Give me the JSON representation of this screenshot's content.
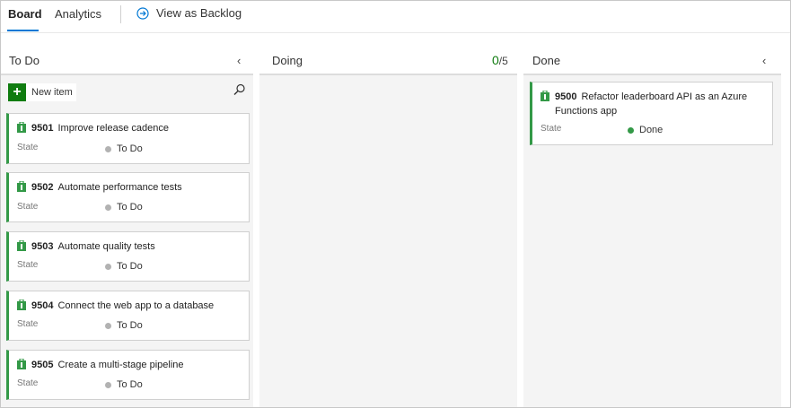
{
  "tabs": {
    "board": "Board",
    "analytics": "Analytics"
  },
  "view_as_backlog": "View as Backlog",
  "columns": {
    "todo": {
      "title": "To Do",
      "new_item": "New item"
    },
    "doing": {
      "title": "Doing",
      "wip_count": "0",
      "wip_limit": "/5"
    },
    "done": {
      "title": "Done"
    }
  },
  "cards_todo": [
    {
      "id": "9501",
      "title": "Improve release cadence",
      "state_label": "State",
      "state": "To Do"
    },
    {
      "id": "9502",
      "title": "Automate performance tests",
      "state_label": "State",
      "state": "To Do"
    },
    {
      "id": "9503",
      "title": "Automate quality tests",
      "state_label": "State",
      "state": "To Do"
    },
    {
      "id": "9504",
      "title": "Connect the web app to a database",
      "state_label": "State",
      "state": "To Do"
    },
    {
      "id": "9505",
      "title": "Create a multi-stage pipeline",
      "state_label": "State",
      "state": "To Do"
    }
  ],
  "cards_done": [
    {
      "id": "9500",
      "title": "Refactor leaderboard API as an Azure Functions app",
      "state_label": "State",
      "state": "Done"
    }
  ],
  "colors": {
    "accent": "#0078d4",
    "card_border": "#339947",
    "wip": "#107c10",
    "todo_dot": "#b2b2b2",
    "done_dot": "#339947"
  }
}
